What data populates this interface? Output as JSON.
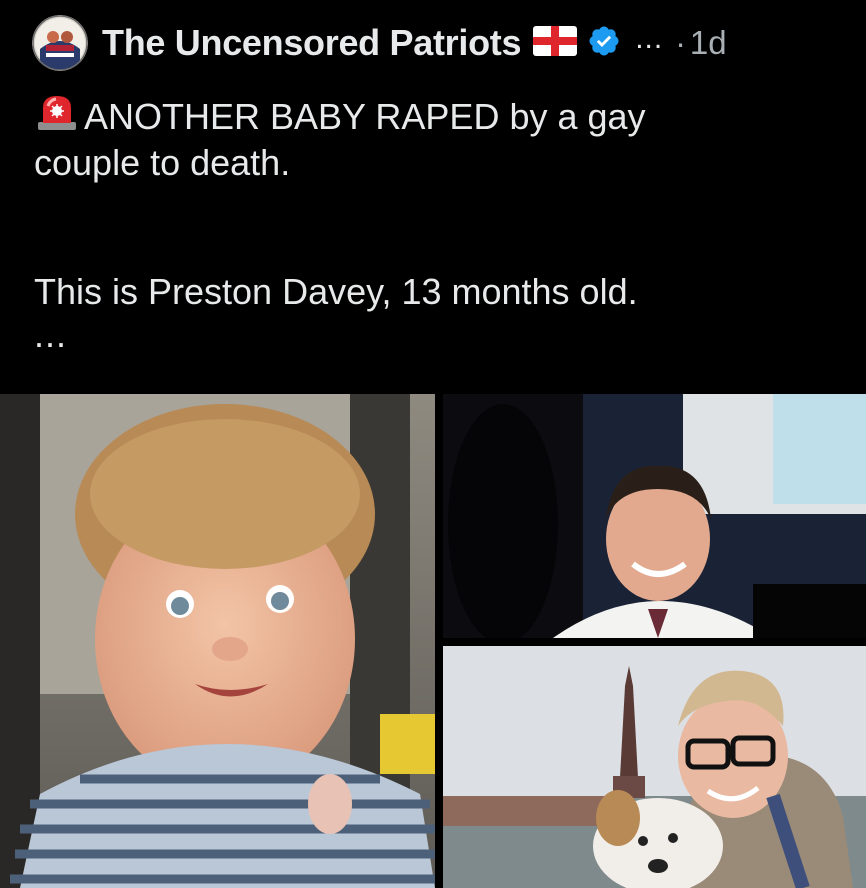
{
  "post": {
    "author": {
      "display_name": "The Uncensored Patriots",
      "avatar_icon": "avatar-image",
      "flag_icon": "england-flag-icon",
      "verified_icon": "verified-badge-icon",
      "verified_color": "#1d9bf0"
    },
    "more_label": "...",
    "separator": "·",
    "timestamp": "1d",
    "text": {
      "siren_icon": "police-siren-icon",
      "line1": "ANOTHER BABY RAPED by a gay",
      "line2": "couple to death.",
      "line3": "This is Preston Davey, 13 months old.",
      "truncation": "..."
    },
    "media": {
      "images": [
        {
          "name": "baby-photo",
          "description": "smiling baby in striped shirt"
        },
        {
          "name": "man-in-shirt-photo",
          "description": "smiling man in white shirt and tie"
        },
        {
          "name": "man-with-dog-photo",
          "description": "man with glasses holding a dog near a tower"
        }
      ]
    }
  },
  "colors": {
    "background": "#000000",
    "text_primary": "#e7e9ea",
    "text_secondary": "#a9b0b5",
    "accent": "#1d9bf0"
  }
}
